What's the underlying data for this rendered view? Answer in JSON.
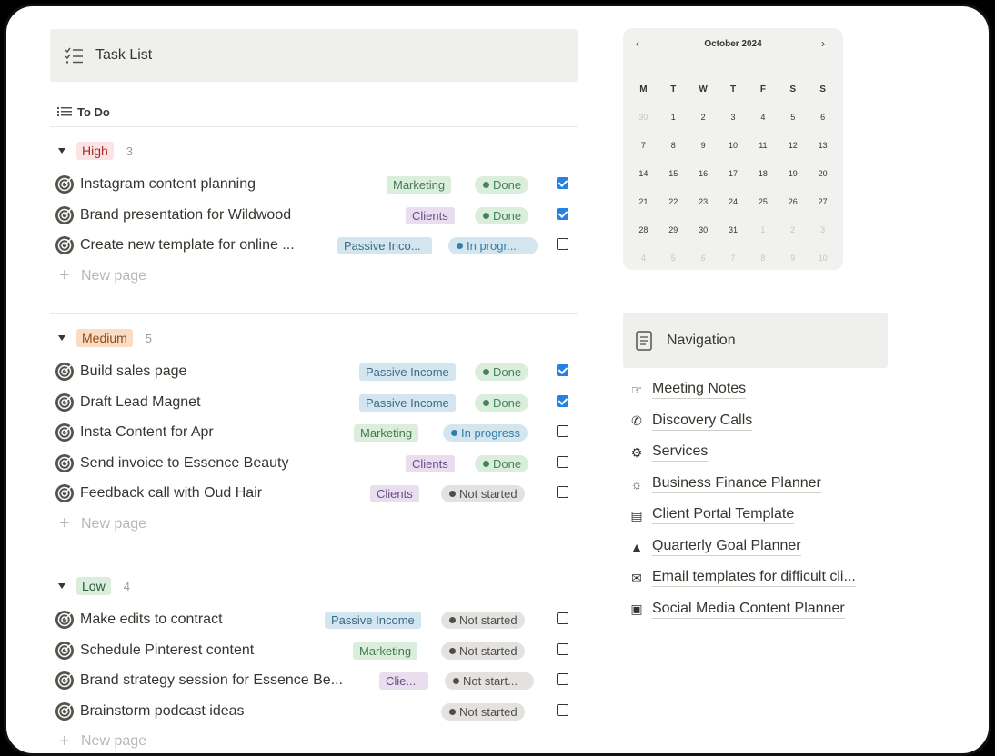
{
  "task_list": {
    "title": "Task List",
    "view": "To Do",
    "new_page_label": "New page",
    "groups": [
      {
        "priority": "High",
        "count": "3",
        "tasks": [
          {
            "name": "Instagram content planning",
            "tag": "Marketing",
            "status": "Done",
            "checked": true
          },
          {
            "name": "Brand presentation for Wildwood",
            "tag": "Clients",
            "status": "Done",
            "checked": true
          },
          {
            "name": "Create new template for online ...",
            "tag": "Passive Inco...",
            "status": "In progr...",
            "checked": false
          }
        ]
      },
      {
        "priority": "Medium",
        "count": "5",
        "tasks": [
          {
            "name": "Build sales page",
            "tag": "Passive Income",
            "status": "Done",
            "checked": true
          },
          {
            "name": "Draft Lead Magnet",
            "tag": "Passive Income",
            "status": "Done",
            "checked": true
          },
          {
            "name": "Insta Content for Apr",
            "tag": "Marketing",
            "status": "In progress",
            "checked": false
          },
          {
            "name": "Send invoice to Essence Beauty",
            "tag": "Clients",
            "status": "Done",
            "checked": false
          },
          {
            "name": "Feedback call with Oud Hair",
            "tag": "Clients",
            "status": "Not started",
            "checked": false
          }
        ]
      },
      {
        "priority": "Low",
        "count": "4",
        "tasks": [
          {
            "name": "Make edits to contract",
            "tag": "Passive Income",
            "status": "Not started",
            "checked": false
          },
          {
            "name": "Schedule Pinterest content",
            "tag": "Marketing",
            "status": "Not started",
            "checked": false
          },
          {
            "name": "Brand strategy session for Essence Be...",
            "tag": "Clie...",
            "status": "Not start...",
            "checked": false
          },
          {
            "name": "Brainstorm podcast ideas",
            "tag": "",
            "status": "Not started",
            "checked": false
          }
        ]
      }
    ]
  },
  "calendar": {
    "month_label": "October 2024",
    "prev_icon": "chevron-left-icon",
    "next_icon": "chevron-right-icon",
    "weekdays": [
      "M",
      "T",
      "W",
      "T",
      "F",
      "S",
      "S"
    ],
    "weeks": [
      [
        "30",
        "1",
        "2",
        "3",
        "4",
        "5",
        "6"
      ],
      [
        "7",
        "8",
        "9",
        "10",
        "11",
        "12",
        "13"
      ],
      [
        "14",
        "15",
        "16",
        "17",
        "18",
        "19",
        "20"
      ],
      [
        "21",
        "22",
        "23",
        "24",
        "25",
        "26",
        "27"
      ],
      [
        "28",
        "29",
        "30",
        "31",
        "1",
        "2",
        "3"
      ],
      [
        "4",
        "5",
        "6",
        "7",
        "8",
        "9",
        "10"
      ]
    ]
  },
  "navigation": {
    "title": "Navigation",
    "items": [
      {
        "label": "Meeting Notes",
        "icon": "handshake-icon"
      },
      {
        "label": "Discovery Calls",
        "icon": "phone-icon"
      },
      {
        "label": "Services",
        "icon": "services-icon"
      },
      {
        "label": "Business Finance Planner",
        "icon": "piggy-bank-icon"
      },
      {
        "label": "Client Portal Template",
        "icon": "portal-icon"
      },
      {
        "label": "Quarterly Goal Planner",
        "icon": "growth-chart-icon"
      },
      {
        "label": "Email templates for difficult cli...",
        "icon": "megaphone-icon"
      },
      {
        "label": "Social Media Content Planner",
        "icon": "camera-icon"
      }
    ]
  },
  "colors": {
    "checkbox_checked": "#2383e2",
    "header_bg": "#efefed",
    "priority_high": "#fbe4e4",
    "priority_medium": "#fbdcc3",
    "priority_low": "#dbeddb"
  }
}
